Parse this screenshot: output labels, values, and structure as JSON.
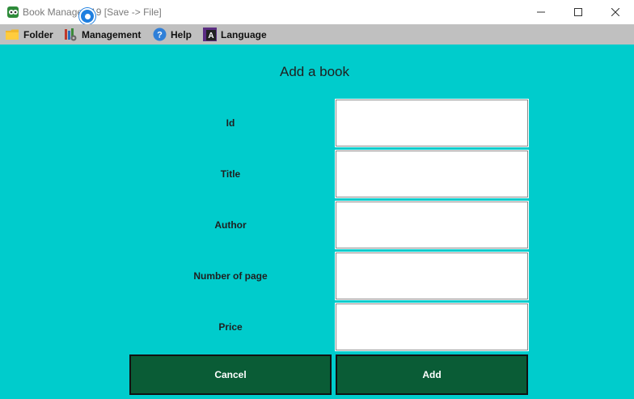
{
  "window": {
    "title": "Book Manage  019 [Save -> File]"
  },
  "menubar": {
    "items": [
      {
        "label": "Folder",
        "icon": "folder-icon"
      },
      {
        "label": "Management",
        "icon": "management-icon"
      },
      {
        "label": "Help",
        "icon": "help-icon"
      },
      {
        "label": "Language",
        "icon": "language-icon"
      }
    ]
  },
  "form": {
    "title": "Add a book",
    "fields": [
      {
        "label": "Id",
        "value": ""
      },
      {
        "label": "Title",
        "value": ""
      },
      {
        "label": "Author",
        "value": ""
      },
      {
        "label": "Number of page",
        "value": ""
      },
      {
        "label": "Price",
        "value": ""
      }
    ],
    "cancel_label": "Cancel",
    "add_label": "Add"
  },
  "colors": {
    "panel_background": "#00cccc",
    "menubar_background": "#c0c0c0",
    "button_background": "#0a5c36"
  }
}
